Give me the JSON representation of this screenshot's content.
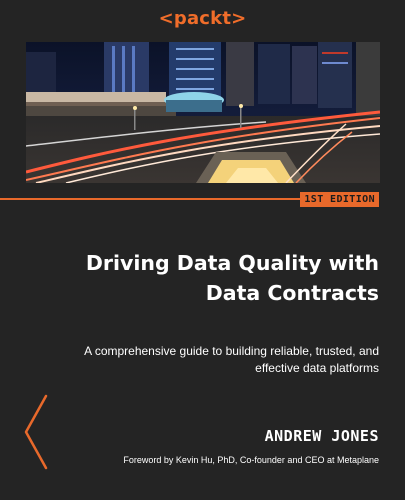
{
  "publisher": {
    "logo_text": "packt"
  },
  "edition": "1ST EDITION",
  "title": "Driving Data Quality with Data Contracts",
  "subtitle": "A comprehensive guide to building reliable, trusted, and effective data platforms",
  "author": "ANDREW JONES",
  "foreword": "Foreword by Kevin Hu, PhD, Co-founder and CEO at Metaplane",
  "colors": {
    "background": "#242424",
    "accent": "#e8692b",
    "text": "#ffffff"
  },
  "icons": [
    "chevron-decoration-icon"
  ]
}
